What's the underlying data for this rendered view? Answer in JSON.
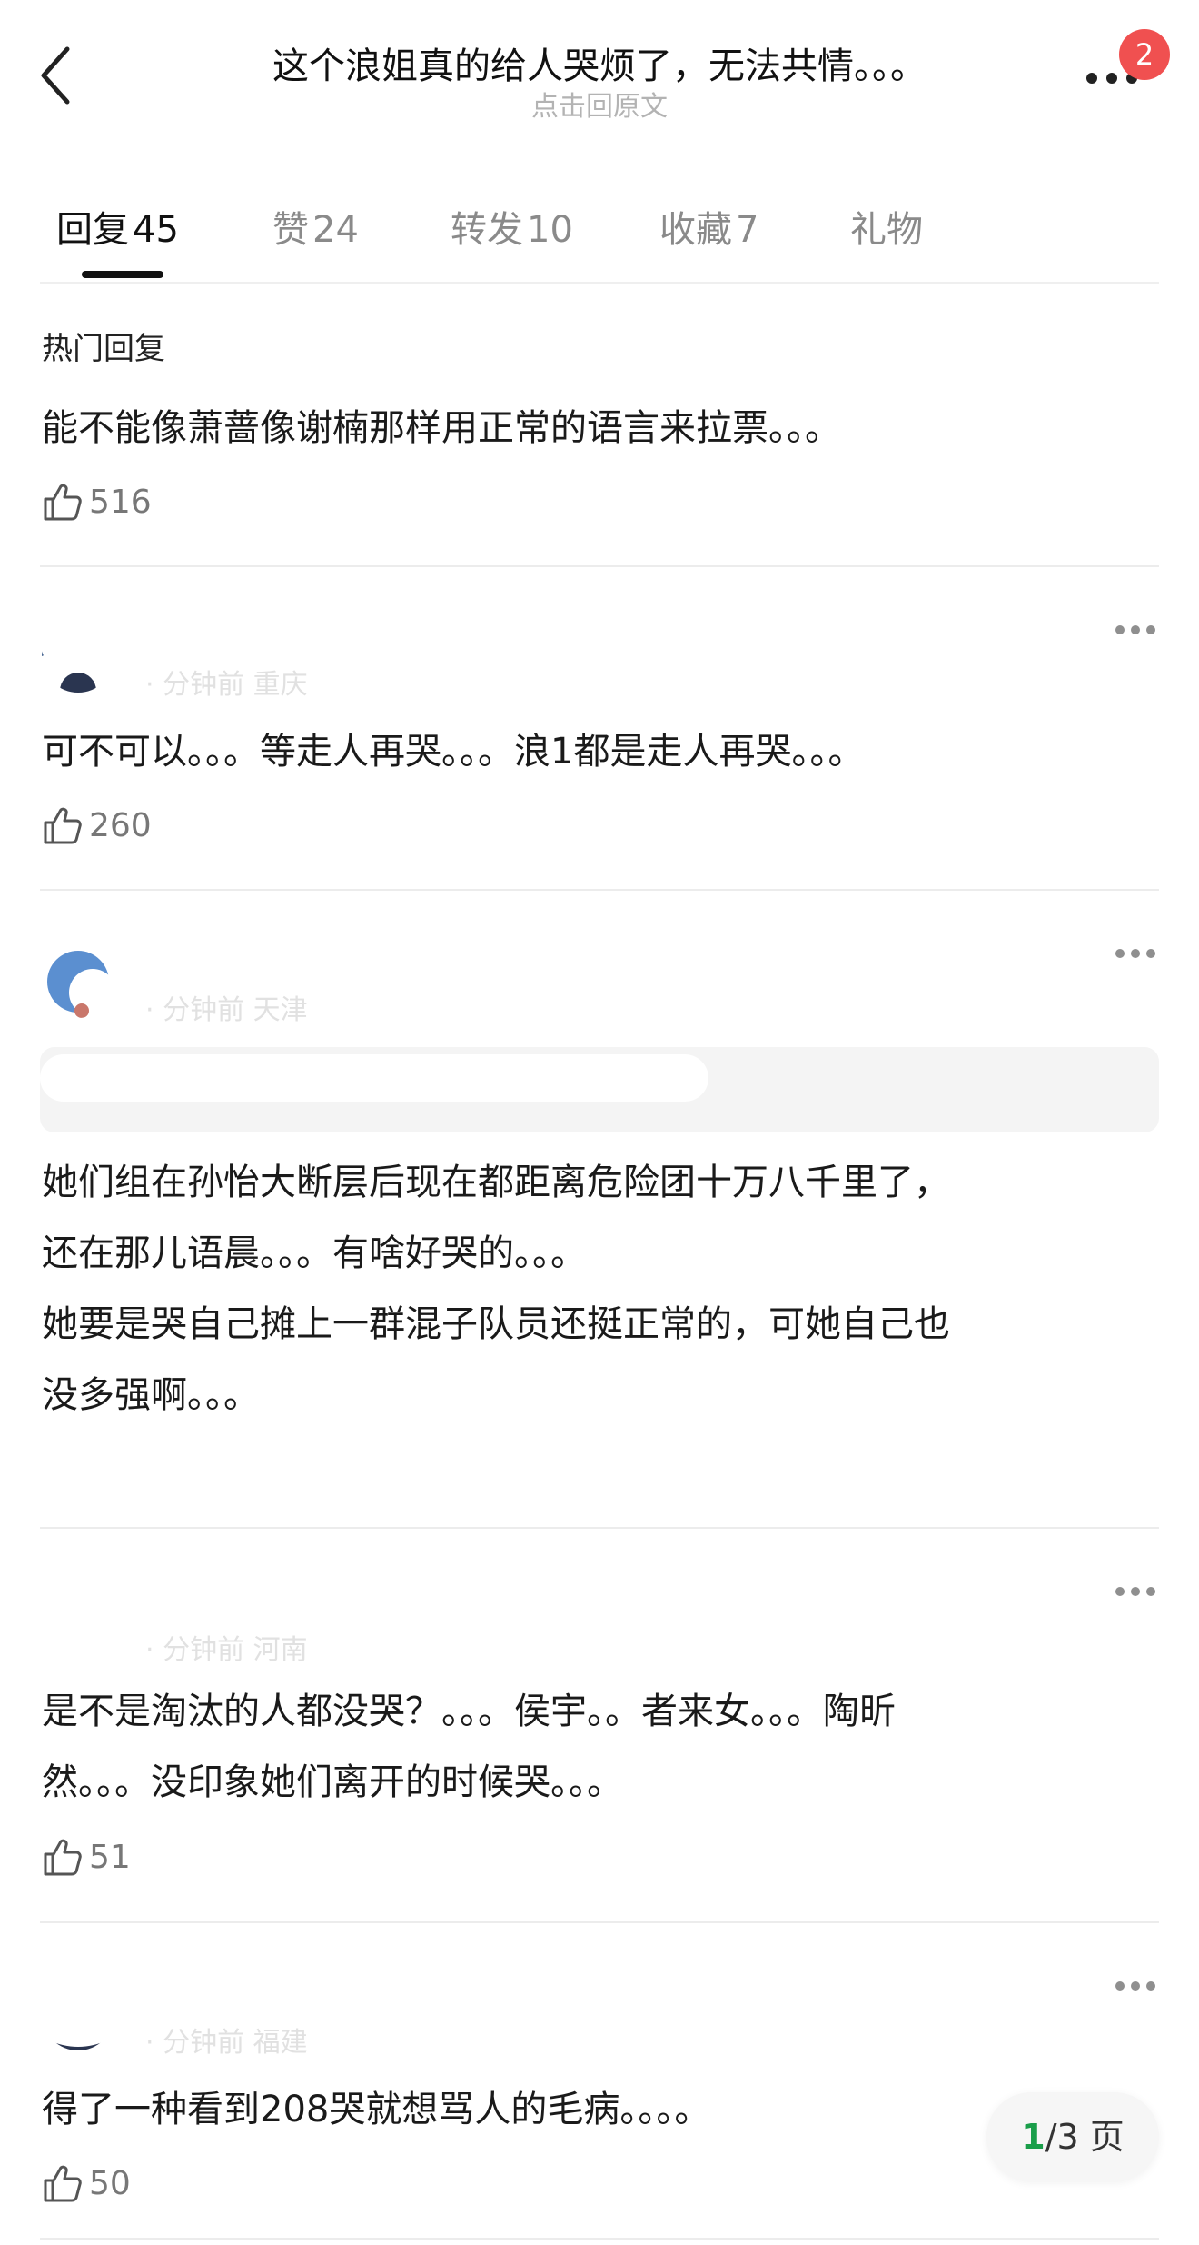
{
  "header": {
    "title": "这个浪姐真的给人哭烦了，无法共情。。。",
    "subtitle": "点击回原文",
    "badge_count": "2"
  },
  "tabs": [
    {
      "label": "回复",
      "count": "45",
      "active": true
    },
    {
      "label": "赞",
      "count": "24",
      "active": false
    },
    {
      "label": "转发",
      "count": "10",
      "active": false
    },
    {
      "label": "收藏",
      "count": "7",
      "active": false
    },
    {
      "label": "礼物",
      "count": "",
      "active": false
    }
  ],
  "hot": {
    "section_title": "热门回复",
    "text": "能不能像萧蔷像谢楠那样用正常的语言来拉票。。。",
    "likes": "516"
  },
  "comments": [
    {
      "meta": "· 分钟前 重庆",
      "text": "可不可以。。。等走人再哭。。。浪1都是走人再哭。。。",
      "likes": "260"
    },
    {
      "meta": "· 分钟前 天津",
      "text": "她们组在孙怡大断层后现在都距离危险团十万八千里了，\n还在那儿语晨。。。有啥好哭的。。。\n她要是哭自己摊上一群混子队员还挺正常的，可她自己也\n没多强啊。。。",
      "likes": ""
    },
    {
      "meta": "· 分钟前 河南",
      "text": "是不是淘汰的人都没哭？。。。侯宇。。者来女。。。陶昕\n然。。。没印象她们离开的时候哭。。。",
      "likes": "51"
    },
    {
      "meta": "· 分钟前 福建",
      "text": "得了一种看到208哭就想骂人的毛病。。。。",
      "likes": "50"
    }
  ],
  "pagination": {
    "current": "1",
    "total_text": "/3 页"
  },
  "colors": {
    "badge": "#f05050",
    "page_current": "#1a9e4a",
    "muted_text": "#8a8a8a"
  }
}
